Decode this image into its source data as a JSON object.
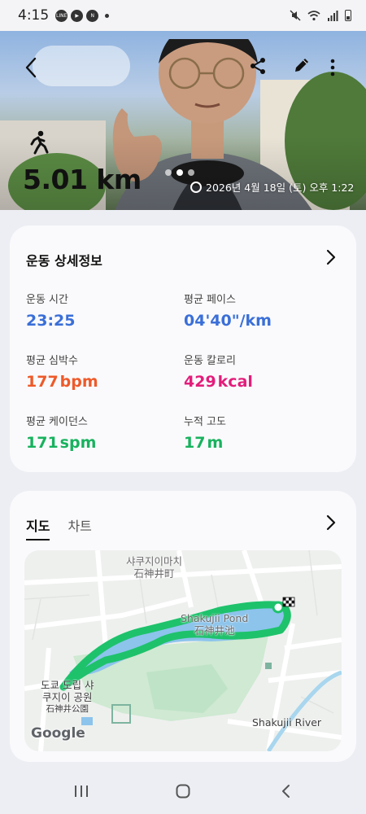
{
  "status_bar": {
    "time": "4:15",
    "notification_icons": [
      "LINE",
      "youtube-icon",
      "news-icon"
    ],
    "right_icons": [
      "mute-icon",
      "wifi-icon",
      "signal-icon",
      "battery-icon"
    ]
  },
  "hero": {
    "distance": "5.01 km",
    "date": "2026년 4월 18일 (토) 오후 1:22",
    "activity_icon": "running-icon"
  },
  "details": {
    "title": "운동 상세정보",
    "stats": [
      {
        "label": "운동 시간",
        "value": "23:25",
        "unit": "",
        "color": "#3a6fd8"
      },
      {
        "label": "평균 페이스",
        "value": "04'40\"",
        "unit": "/km",
        "color": "#3a6fd8"
      },
      {
        "label": "평균 심박수",
        "value": "177",
        "unit": "bpm",
        "color": "#ee5a2a"
      },
      {
        "label": "운동 칼로리",
        "value": "429",
        "unit": "kcal",
        "color": "#e31d7b"
      },
      {
        "label": "평균 케이던스",
        "value": "171",
        "unit": "spm",
        "color": "#18b25e"
      },
      {
        "label": "누적 고도",
        "value": "17",
        "unit": "m",
        "color": "#18b25e"
      }
    ]
  },
  "map_card": {
    "tabs": [
      "지도",
      "차트"
    ],
    "active_tab": "지도",
    "labels": {
      "district_ko": "샤쿠지이마치",
      "district_jp": "石神井町",
      "pond_en": "Shakujii Pond",
      "pond_jp": "石神井池",
      "park_ko_1": "도쿄 도립 샤",
      "park_ko_2": "쿠지이 공원",
      "park_jp": "石神井公園",
      "river": "Shakujii River",
      "google": "Google"
    },
    "route_color": "#1ec26b"
  }
}
